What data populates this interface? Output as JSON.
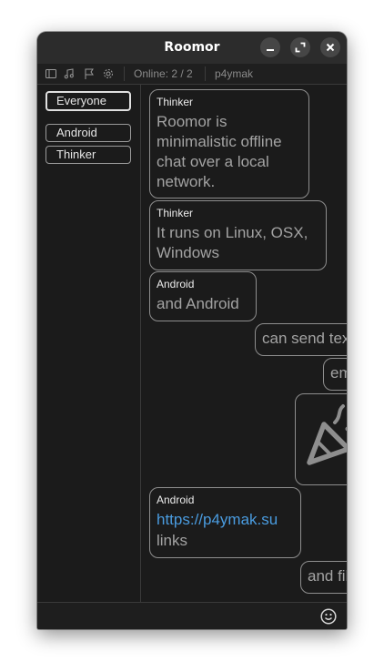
{
  "window": {
    "title": "Roomor"
  },
  "toolbar": {
    "online_text": "Online: 2 / 2",
    "username": "p4ymak",
    "icons": [
      "sidebar-toggle-icon",
      "music-note-icon",
      "flag-icon",
      "gear-icon"
    ]
  },
  "sidebar": {
    "peers": [
      "Everyone",
      "Android",
      "Thinker"
    ],
    "selected": "Everyone"
  },
  "messages": [
    {
      "sender": "Thinker",
      "lines": [
        "Roomor is",
        "minimalistic offline",
        "chat over a local",
        "network."
      ]
    },
    {
      "sender": "Thinker",
      "lines": [
        "It runs on Linux, OSX,",
        "Windows"
      ]
    },
    {
      "sender": "Android",
      "lines": [
        "and Android"
      ]
    },
    {
      "sender": "",
      "lines": [
        "can send texts"
      ]
    },
    {
      "sender": "",
      "lines": [
        "emoji"
      ]
    },
    {
      "sender": "",
      "emoji": "party-popper-icon"
    },
    {
      "sender": "Android",
      "link": "https://p4ymak.su",
      "lines": [
        "links"
      ]
    },
    {
      "sender": "",
      "lines": [
        "and files"
      ]
    }
  ],
  "colors": {
    "link": "#4a9ce0",
    "background": "#1b1b1b",
    "titlebar": "#2c2c2c"
  }
}
